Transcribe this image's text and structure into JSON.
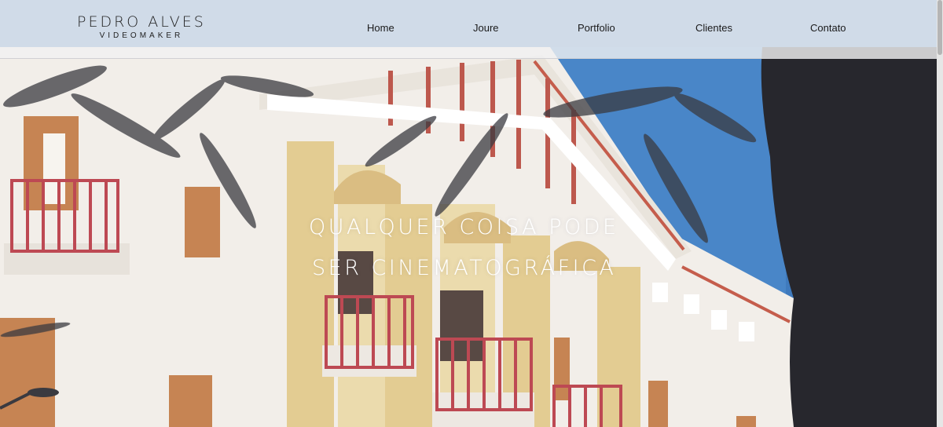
{
  "brand": {
    "name": "PEDRO ALVES",
    "tagline": "VIDEOMAKER"
  },
  "nav": {
    "items": [
      {
        "label": "Home"
      },
      {
        "label": "Joure"
      },
      {
        "label": "Portfolio"
      },
      {
        "label": "Clientes"
      },
      {
        "label": "Contato"
      }
    ]
  },
  "hero": {
    "line1": "QUALQUER COISA PODE",
    "line2": "SER CINEMATOGRÁFICA",
    "image_subject": "white-and-yellow-building-with-red-balconies-and-palm-leaves"
  },
  "colors": {
    "sky": "#2f6fb8",
    "wall": "#f1ede8",
    "ochre": "#e1c889",
    "railing": "#b83a45",
    "shutter": "#c27a45"
  }
}
